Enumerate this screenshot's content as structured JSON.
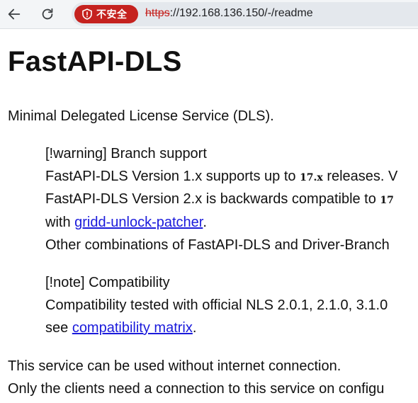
{
  "browser": {
    "security_label": "不安全",
    "url_scheme": "https",
    "url_rest": "://192.168.136.150/-/readme"
  },
  "page": {
    "title": "FastAPI-DLS",
    "intro": "Minimal Delegated License Service (DLS).",
    "warning": {
      "heading": "[!warning] Branch support",
      "line1_pre": "FastAPI-DLS Version 1.x supports up to ",
      "line1_code": "17.x",
      "line1_post": " releases. V",
      "line2_pre": "FastAPI-DLS Version 2.x is backwards compatible to ",
      "line2_code": "17",
      "line3_pre": "with ",
      "line3_link": "gridd-unlock-patcher",
      "line3_post": ".",
      "line4": "Other combinations of FastAPI-DLS and Driver-Branch"
    },
    "note": {
      "heading": "[!note] Compatibility",
      "line1": "Compatibility tested with official NLS 2.0.1, 2.1.0, 3.1.0",
      "line2_pre": "see ",
      "line2_link": "compatibility matrix",
      "line2_post": "."
    },
    "para1": "This service can be used without internet connection.",
    "para2": "Only the clients need a connection to this service on configu"
  },
  "colors": {
    "security_chip": "#c5221f",
    "link": "#1a1adb"
  }
}
